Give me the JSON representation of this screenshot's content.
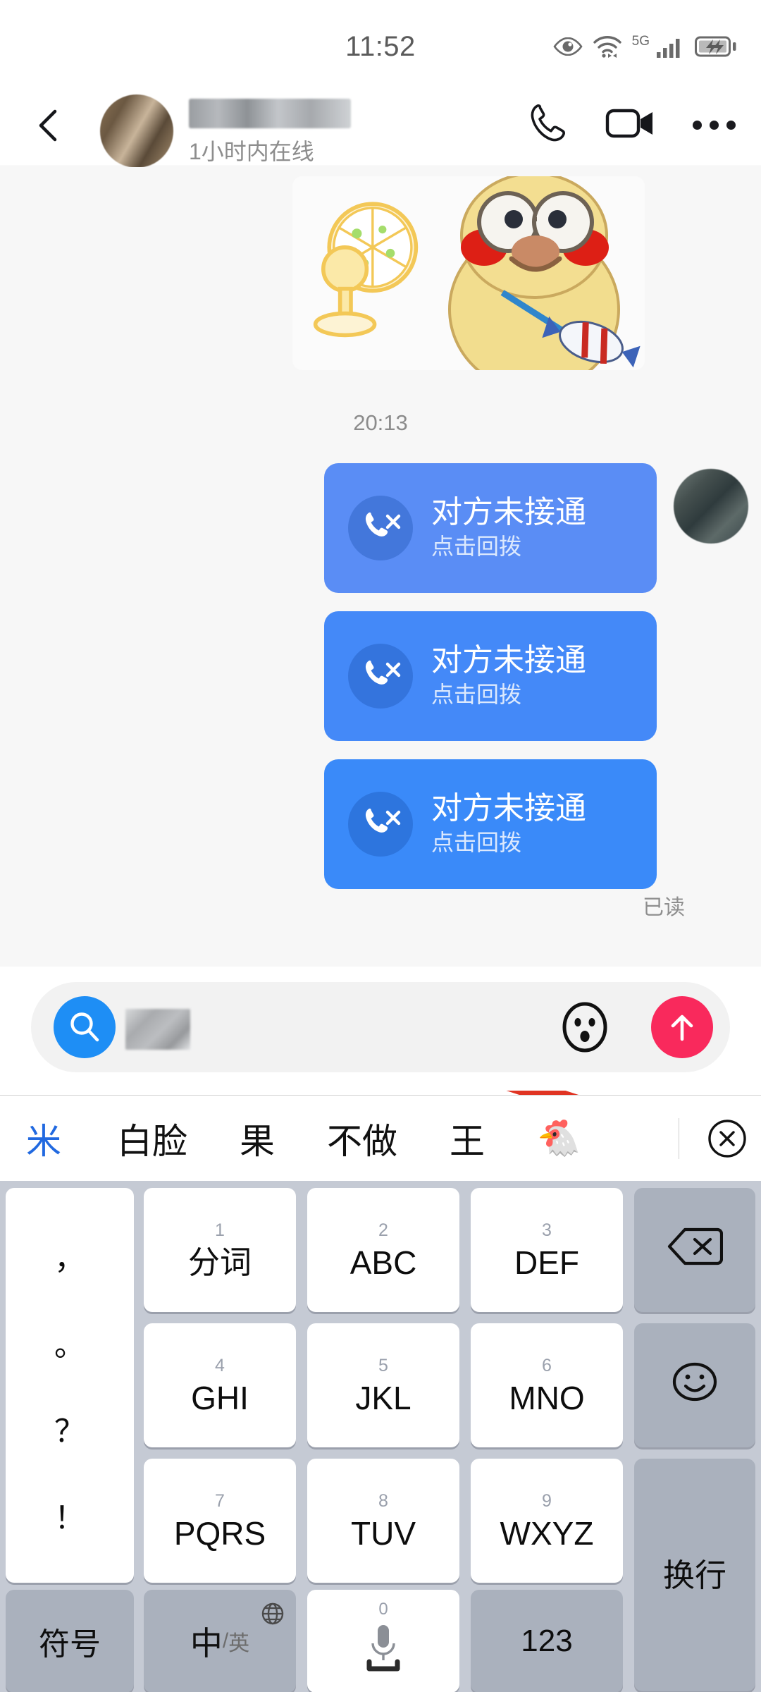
{
  "status_bar": {
    "time": "11:52",
    "network_label": "5G",
    "icons": [
      "eye-care-icon",
      "wifi-icon",
      "signal-bars-icon",
      "battery-charging-icon"
    ]
  },
  "chat_header": {
    "back_icon": "chevron-left-icon",
    "contact_name": "",
    "presence": "1小时内在线",
    "call_icon": "phone-icon",
    "video_icon": "video-camera-icon",
    "more_icon": "more-options-icon"
  },
  "conversation": {
    "time_divider": "20:13",
    "sticker": {
      "alt": "yellow chick sticker with glasses and electric fan"
    },
    "call_messages": [
      {
        "title": "对方未接通",
        "subtitle": "点击回拨",
        "icon": "missed-call-icon"
      },
      {
        "title": "对方未接通",
        "subtitle": "点击回拨",
        "icon": "missed-call-icon"
      },
      {
        "title": "对方未接通",
        "subtitle": "点击回拨",
        "icon": "missed-call-icon"
      }
    ],
    "read_receipt": "已读",
    "annotation": {
      "type": "red-arrow",
      "color": "#e03423"
    }
  },
  "input_bar": {
    "search_icon": "search-icon",
    "typed_value": "",
    "placeholder": "",
    "emoji_icon": "emoji-face-icon",
    "send_icon": "send-arrow-up-icon",
    "send_color": "#f9295c",
    "search_color": "#1e8ef5"
  },
  "candidate_bar": {
    "pinyin": "米",
    "candidates": [
      "白脸",
      "果",
      "不做",
      "王",
      "🐔"
    ],
    "close_icon": "close-circle-icon"
  },
  "keyboard": {
    "punctuation_key": [
      "，",
      "。",
      "？",
      "！"
    ],
    "rows": [
      [
        {
          "num": "1",
          "label": "分词",
          "style": "white"
        },
        {
          "num": "2",
          "label": "ABC",
          "style": "white"
        },
        {
          "num": "3",
          "label": "DEF",
          "style": "white"
        }
      ],
      [
        {
          "num": "4",
          "label": "GHI",
          "style": "white"
        },
        {
          "num": "5",
          "label": "JKL",
          "style": "white"
        },
        {
          "num": "6",
          "label": "MNO",
          "style": "white"
        }
      ],
      [
        {
          "num": "7",
          "label": "PQRS",
          "style": "white"
        },
        {
          "num": "8",
          "label": "TUV",
          "style": "white"
        },
        {
          "num": "9",
          "label": "WXYZ",
          "style": "white"
        }
      ]
    ],
    "side_keys": {
      "backspace_icon": "backspace-icon",
      "emoji_icon": "smiley-icon",
      "enter_label": "换行"
    },
    "bottom_row": {
      "symbols_label": "符号",
      "lang_primary": "中",
      "lang_divider": "/",
      "lang_secondary": "英",
      "globe_icon": "globe-icon",
      "space_zero": "0",
      "mic_icon": "microphone-icon",
      "numeric_label": "123"
    }
  }
}
